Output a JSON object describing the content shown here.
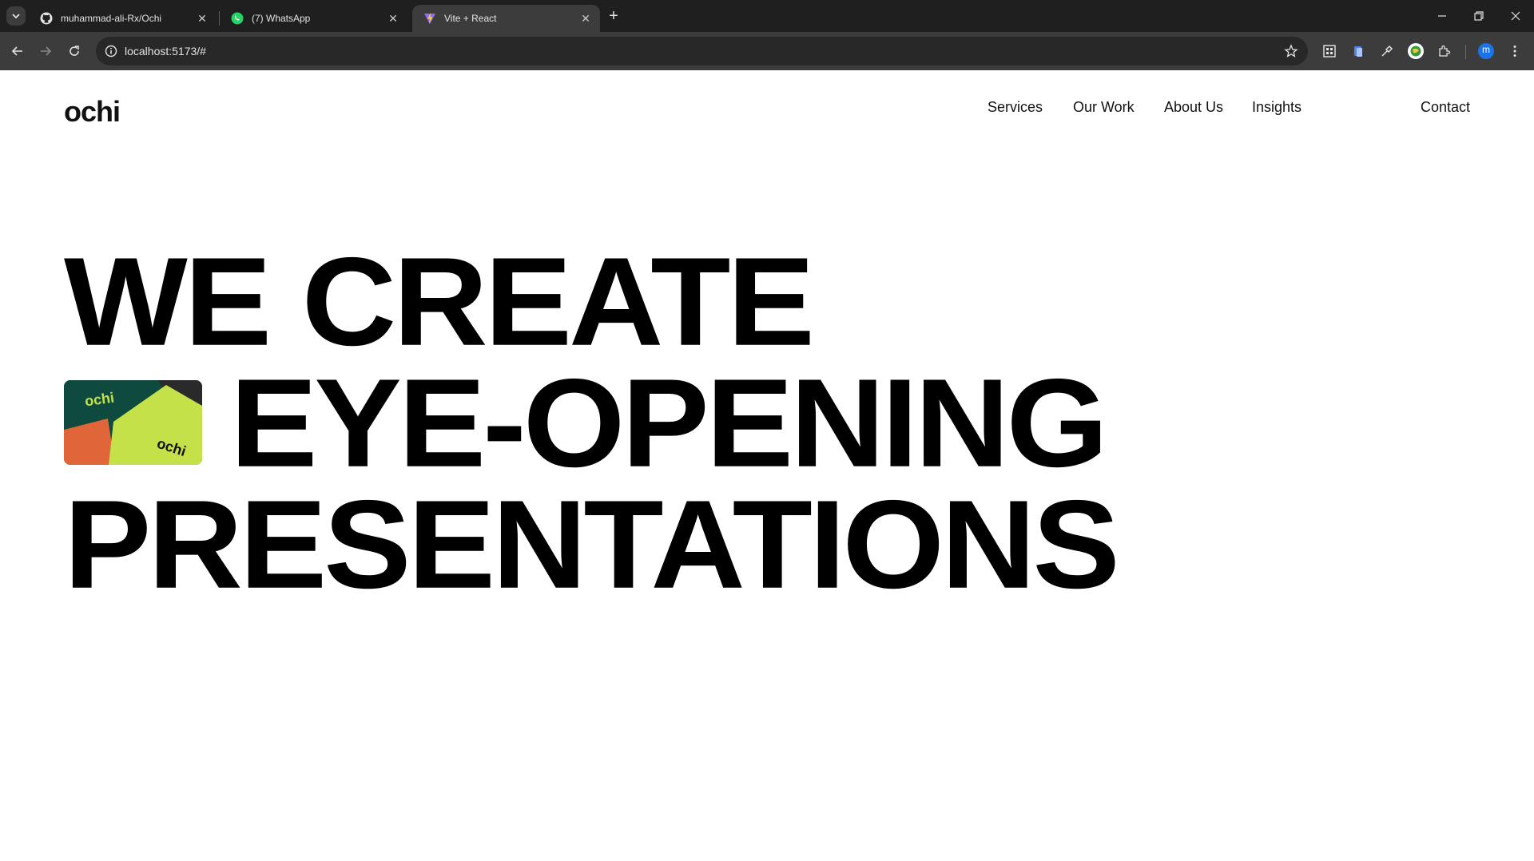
{
  "browser": {
    "tabs": [
      {
        "title": "muhammad-ali-Rx/Ochi",
        "icon": "github-icon",
        "active": false
      },
      {
        "title": "(7) WhatsApp",
        "icon": "whatsapp-icon",
        "active": false
      },
      {
        "title": "Vite + React",
        "icon": "vite-icon",
        "active": true
      }
    ],
    "close_glyph": "✕",
    "new_tab_glyph": "+",
    "url": "localhost:5173/#",
    "profile_initial": "m"
  },
  "site": {
    "logo": "ochi",
    "nav": [
      "Services",
      "Our Work",
      "About Us",
      "Insights"
    ],
    "contact": "Contact",
    "headline": [
      "WE CREATE",
      "EYE-OPENING",
      "PRESENTATIONS"
    ],
    "promo_card": {
      "logo_top": "ochi",
      "logo_bottom": "ochi"
    }
  },
  "colors": {
    "chrome_dark": "#1f1f1f",
    "chrome_toolbar": "#3c3c3c",
    "page_bg": "#ffffff",
    "text": "#000000",
    "promo_green": "#0f4a3e",
    "promo_lime": "#c5e14a",
    "promo_orange": "#e0663a"
  }
}
